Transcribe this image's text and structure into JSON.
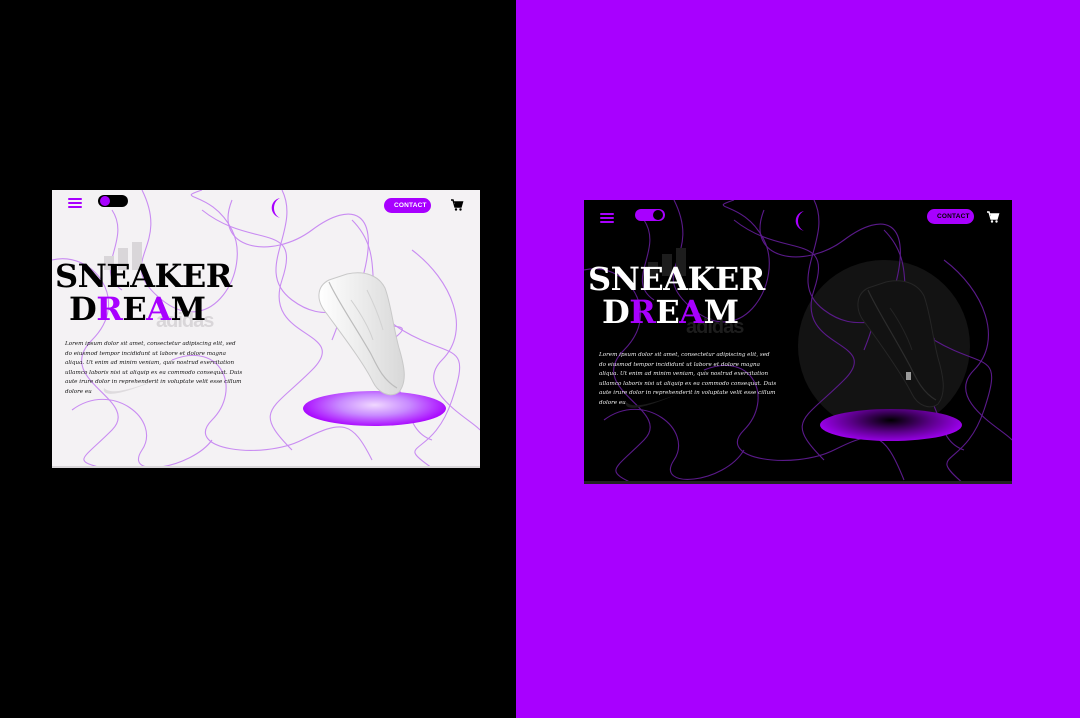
{
  "theme_colors": {
    "accent": "#a800ff",
    "dark_bg": "#000000",
    "light_bg": "#f4f2f4"
  },
  "icons": [
    "menu-icon",
    "toggle-switch",
    "crescent-logo-icon",
    "cart-icon",
    "adidas-stripes-icon",
    "swoosh-icon"
  ],
  "light": {
    "nav": {
      "contact_label": "CONTACT"
    },
    "background_brand": "adidas",
    "headline": {
      "line1": "SNEAKER",
      "line2_a": "D",
      "line2_b": "R",
      "line2_c": "E",
      "line2_d": "A",
      "line2_e": "M"
    },
    "body": "Lorem ipsum dolor sit amet, consectetur adipiscing elit, sed do eiusmod tempor incididunt ut labore et dolore magna aliqua. Ut enim ad minim veniam, quis nostrud exercitation ullamco laboris nisi ut aliquip ex ea commodo consequat. Duis aute irure dolor in reprehenderit in voluptate velit esse cillum dolore eu"
  },
  "dark": {
    "nav": {
      "contact_label": "CONTACT"
    },
    "background_brand": "adidas",
    "headline": {
      "line1": "SNEAKER",
      "line2_a": "D",
      "line2_b": "R",
      "line2_c": "E",
      "line2_d": "A",
      "line2_e": "M"
    },
    "body": "Lorem ipsum dolor sit amet, consectetur adipiscing elit, sed do eiusmod tempor incididunt ut labore et dolore magna aliqua. Ut enim ad minim veniam, quis nostrud exercitation ullamco laboris nisi ut aliquip ex ea commodo consequat. Duis aute irure dolor in reprehenderit in voluptate velit esse cillum dolore eu"
  }
}
